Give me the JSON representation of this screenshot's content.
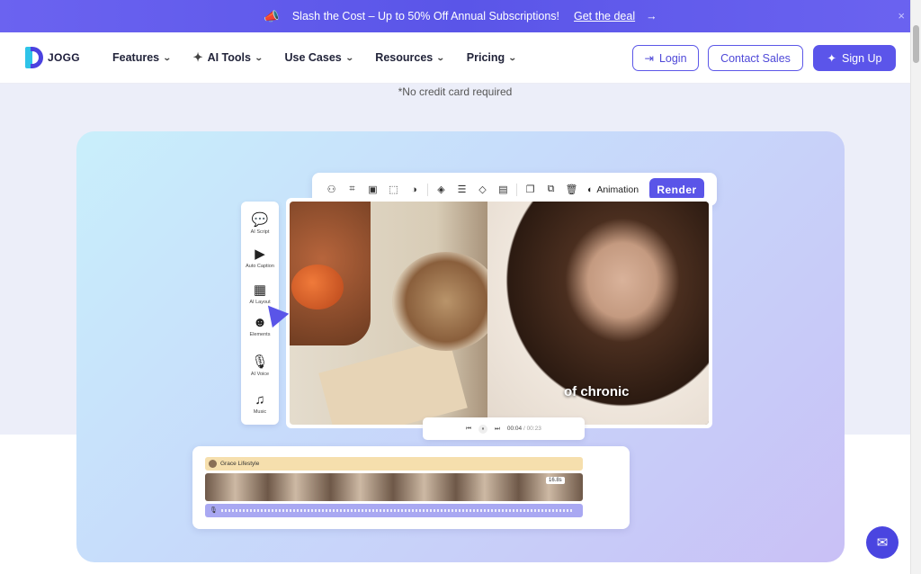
{
  "banner": {
    "text": "Slash the Cost – Up to 50% Off Annual Subscriptions!",
    "link": "Get the deal",
    "arrow": "→",
    "close": "×"
  },
  "nav": {
    "logo_text": "JOGG",
    "menu": [
      {
        "label": "Features"
      },
      {
        "label": "AI Tools"
      },
      {
        "label": "Use Cases"
      },
      {
        "label": "Resources"
      },
      {
        "label": "Pricing"
      }
    ],
    "login": "Login",
    "contact": "Contact Sales",
    "signup": "Sign Up"
  },
  "hero": {
    "no_cc": "*No credit card required"
  },
  "editor": {
    "toolbar": {
      "animation": "Animation",
      "render": "Render"
    },
    "rail": [
      {
        "label": "AI Script",
        "icon": "ai-script-icon"
      },
      {
        "label": "Auto Caption",
        "icon": "auto-caption-icon"
      },
      {
        "label": "AI Layout",
        "icon": "ai-layout-icon"
      },
      {
        "label": "Elements",
        "icon": "elements-icon"
      },
      {
        "label": "AI Voice",
        "icon": "ai-voice-icon"
      },
      {
        "label": "Music",
        "icon": "music-icon"
      }
    ],
    "caption": "of chronic",
    "playback": {
      "current": "00:04",
      "total": "/ 00:23"
    },
    "timeline": {
      "track_name": "Grace Lifestyle",
      "duration": "16.8s"
    }
  },
  "colors": {
    "accent": "#5a55e8",
    "banner": "#6b63f0"
  }
}
